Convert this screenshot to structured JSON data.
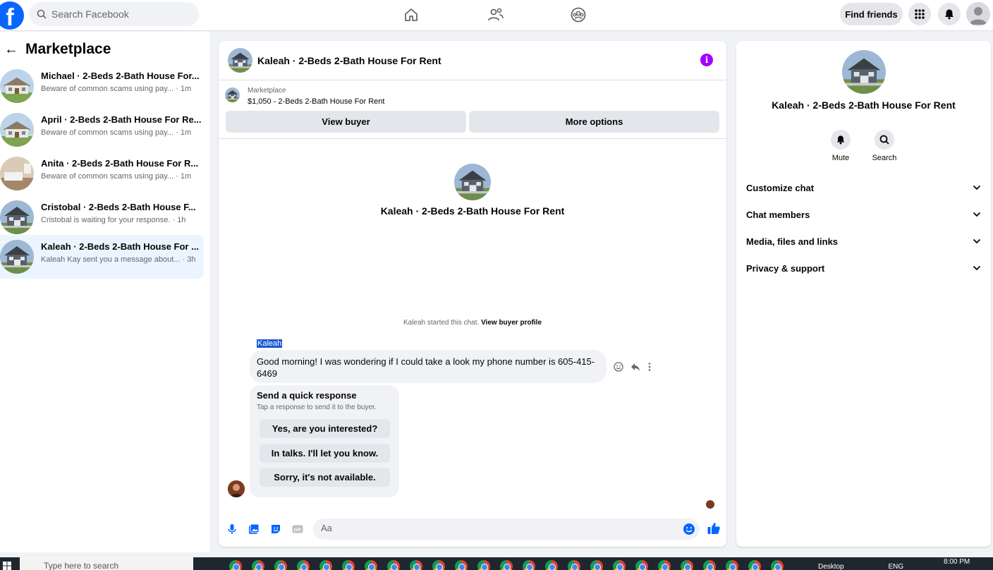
{
  "colors": {
    "brand": "#0866ff",
    "info": "#a200ff",
    "like": "#0866ff",
    "active_row": "#ebf5ff"
  },
  "topbar": {
    "logo": "f",
    "search_placeholder": "Search Facebook",
    "nav_icons": [
      "home-icon",
      "friends-icon",
      "groups-icon"
    ],
    "find_friends": "Find friends"
  },
  "sidebar": {
    "title": "Marketplace",
    "conversations": [
      {
        "name": "Michael · 2-Beds 2-Bath House For...",
        "preview": "Beware of common scams using pay... · 1m"
      },
      {
        "name": "April · 2-Beds 2-Bath House For Re...",
        "preview": "Beware of common scams using pay... · 1m"
      },
      {
        "name": "Anita · 2-Beds 2-Bath House For R...",
        "preview": "Beware of common scams using pay... · 1m"
      },
      {
        "name": "Cristobal · 2-Beds 2-Bath House F...",
        "preview": "Cristobal is waiting for your response. · 1h"
      },
      {
        "name": "Kaleah · 2-Beds 2-Bath House For ...",
        "preview": "Kaleah Kay sent you a message about... · 3h",
        "active": true
      }
    ]
  },
  "chat": {
    "title": "Kaleah · 2-Beds 2-Bath House For Rent",
    "listing_label": "Marketplace",
    "listing_price": "$1,050 - 2-Beds 2-Bath House For Rent",
    "view_buyer": "View buyer",
    "more_options": "More options",
    "center_title": "Kaleah · 2-Beds 2-Bath House For Rent",
    "started_text": "Kaleah started this chat.",
    "view_buyer_profile": "View buyer profile",
    "sender": "Kaleah",
    "message": "Good morning! I was wondering if I could take a look my phone number is 605-415-6469",
    "quick_title": "Send a quick response",
    "quick_subtitle": "Tap a response to send it to the buyer.",
    "quick_responses": [
      "Yes, are you interested?",
      "In talks. I'll let you know.",
      "Sorry, it's not available."
    ],
    "composer_placeholder": "Aa"
  },
  "details": {
    "title": "Kaleah · 2-Beds 2-Bath House For Rent",
    "mute": "Mute",
    "search": "Search",
    "rows": [
      "Customize chat",
      "Chat members",
      "Media, files and links",
      "Privacy & support"
    ]
  },
  "taskbar": {
    "search_placeholder": "Type here to search",
    "tray_label": "Desktop",
    "language": "ENG",
    "time": "8:00 PM"
  }
}
